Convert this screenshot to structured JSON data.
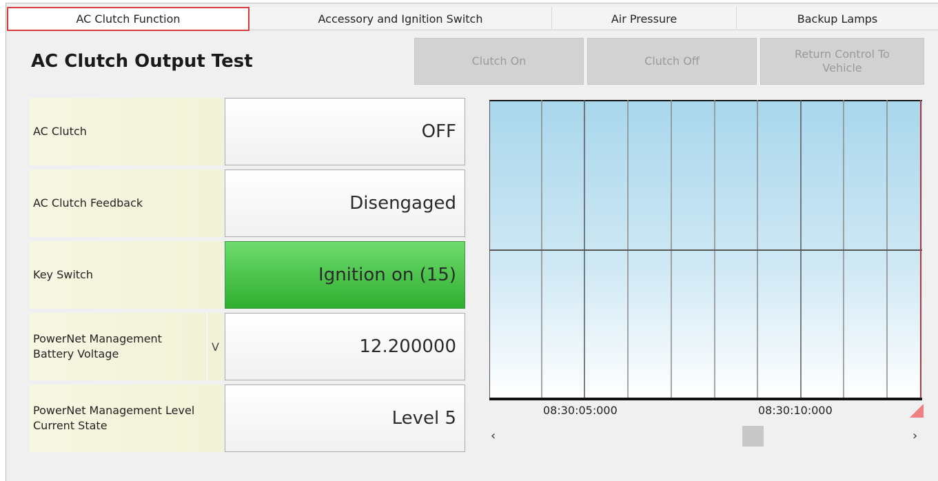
{
  "tabs": [
    {
      "label": "AC Clutch Function",
      "active": true
    },
    {
      "label": "Accessory and Ignition Switch",
      "active": false
    },
    {
      "label": "Air Pressure",
      "active": false
    },
    {
      "label": "Backup Lamps",
      "active": false
    }
  ],
  "page_title": "AC Clutch Output Test",
  "buttons": {
    "clutch_on": "Clutch On",
    "clutch_off": "Clutch Off",
    "return_control": "Return Control To Vehicle"
  },
  "rows": [
    {
      "label": "AC Clutch",
      "value": "OFF"
    },
    {
      "label": "AC Clutch Feedback",
      "value": "Disengaged"
    },
    {
      "label": "Key Switch",
      "value": "Ignition on (15)"
    },
    {
      "label": "PowerNet Management Battery Voltage",
      "unit": "V",
      "value": "12.200000"
    },
    {
      "label": "PowerNet Management Level Current State",
      "value": "Level 5"
    }
  ],
  "chart": {
    "time_labels": [
      "08:30:05:000",
      "08:30:10:000"
    ],
    "scroll_left": "‹",
    "scroll_right": "›"
  },
  "colors": {
    "active_tab_border": "#d83a3a",
    "highlight_green": "#3cbf3c",
    "plot_top": "#a9d7ec"
  }
}
